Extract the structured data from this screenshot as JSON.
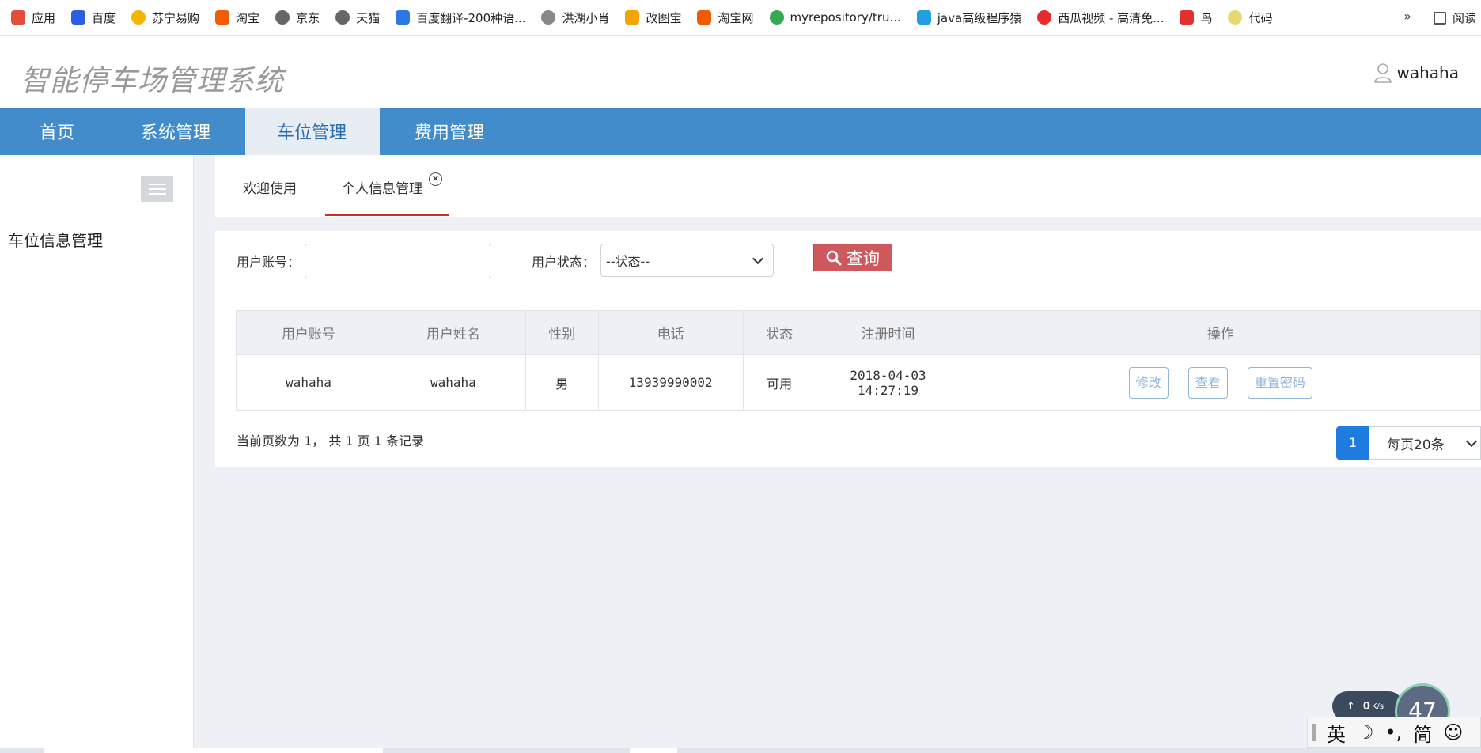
{
  "bookmarks": [
    {
      "label": "应用",
      "color": "#e44d3a"
    },
    {
      "label": "百度",
      "color": "#2b5fe0"
    },
    {
      "label": "苏宁易购",
      "color": "#f5b400"
    },
    {
      "label": "淘宝",
      "color": "#f35b00"
    },
    {
      "label": "京东",
      "color": "#666666"
    },
    {
      "label": "天猫",
      "color": "#666666"
    },
    {
      "label": "百度翻译-200种语...",
      "color": "#2b78e4"
    },
    {
      "label": "洪湖小肖",
      "color": "#888888"
    },
    {
      "label": "改图宝",
      "color": "#f5a300"
    },
    {
      "label": "淘宝网",
      "color": "#f35b00"
    },
    {
      "label": "myrepository/tru...",
      "color": "#34a853"
    },
    {
      "label": "java高级程序猿",
      "color": "#20a0e0"
    },
    {
      "label": "西瓜视频 - 高清免...",
      "color": "#e62b2b"
    },
    {
      "label": "鸟",
      "color": "#e03030"
    },
    {
      "label": "代码",
      "color": "#e8d870"
    }
  ],
  "bookmarks_more": "»",
  "bookmarks_read": "阅读",
  "app": {
    "title": "智能停车场管理系统",
    "username": "wahaha"
  },
  "nav": {
    "items": [
      "首页",
      "系统管理",
      "车位管理",
      "费用管理"
    ],
    "active": "车位管理"
  },
  "sidebar": {
    "item": "车位信息管理"
  },
  "tabs": {
    "welcome": "欢迎使用",
    "personal": "个人信息管理",
    "close_glyph": "×"
  },
  "search": {
    "account_label": "用户账号：",
    "account_value": "",
    "status_label": "用户状态：",
    "status_selected": "--状态--",
    "button": "查询"
  },
  "table": {
    "headers": [
      "用户账号",
      "用户姓名",
      "性别",
      "电话",
      "状态",
      "注册时间",
      "操作"
    ],
    "rows": [
      {
        "account": "wahaha",
        "name": "wahaha",
        "gender": "男",
        "phone": "13939990002",
        "status": "可用",
        "registered": "2018-04-03 14:27:19",
        "actions": [
          "修改",
          "查看",
          "重置密码"
        ]
      }
    ]
  },
  "pager": {
    "info": "当前页数为 1， 共 1 页  1 条记录",
    "current_page": "1",
    "per_page": "每页20条"
  },
  "widgets": {
    "speed": "0",
    "speed_unit": "K/s",
    "circle_value": "47",
    "ime": [
      "英",
      "☽",
      "•,",
      "简",
      "☺"
    ]
  },
  "colors": {
    "nav_bg": "#428ccb",
    "search_button": "#cf585c",
    "page_active": "#1e7be0",
    "action_button": "#8fb4dd"
  }
}
